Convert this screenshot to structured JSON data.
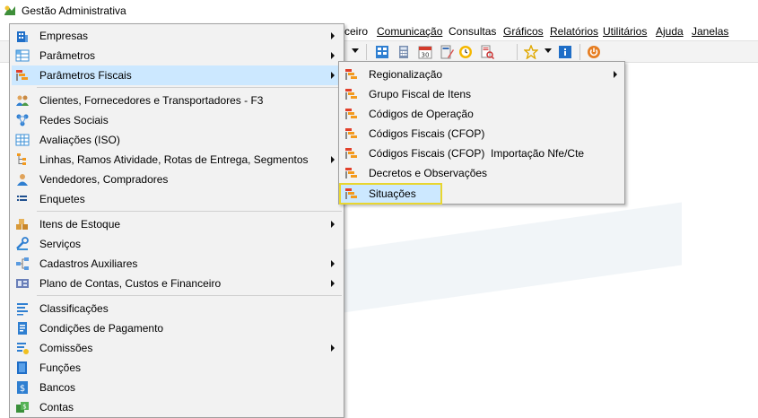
{
  "window": {
    "title": "Gestão Administrativa"
  },
  "menubar": {
    "items": [
      {
        "label": "ceiro",
        "underline_index": -1
      },
      {
        "label": "Comunicação",
        "underline_index": 0
      },
      {
        "label": "Consultas",
        "underline_index": 1
      },
      {
        "label": "Gráficos",
        "underline_index": 0
      },
      {
        "label": "Relatórios",
        "underline_index": 0
      },
      {
        "label": "Utilitários",
        "underline_index": 0
      },
      {
        "label": "Ajuda",
        "underline_index": 0
      },
      {
        "label": "Janelas",
        "underline_index": 0
      }
    ]
  },
  "main_menu": {
    "items": [
      {
        "label": "Empresas",
        "icon": "building-icon",
        "submenu": true
      },
      {
        "label": "Parâmetros",
        "icon": "grid-icon",
        "submenu": true
      },
      {
        "label": "Parâmetros Fiscais",
        "icon": "fiscal-list-icon",
        "submenu": true,
        "highlighted": true
      },
      {
        "label": "Clientes, Fornecedores e Transportadores - F3",
        "icon": "people-icon",
        "submenu": false
      },
      {
        "label": "Redes Sociais",
        "icon": "network-icon",
        "submenu": false
      },
      {
        "label": "Avaliações (ISO)",
        "icon": "table-icon",
        "submenu": false
      },
      {
        "label": "Linhas, Ramos Atividade, Rotas de Entrega, Segmentos",
        "icon": "tree-icon",
        "submenu": true
      },
      {
        "label": "Vendedores, Compradores",
        "icon": "user-icon",
        "submenu": false
      },
      {
        "label": "Enquetes",
        "icon": "list-icon",
        "submenu": false
      },
      {
        "label": "Itens de Estoque",
        "icon": "boxes-icon",
        "submenu": true
      },
      {
        "label": "Serviços",
        "icon": "tools-icon",
        "submenu": false
      },
      {
        "label": "Cadastros Auxiliares",
        "icon": "nodes-icon",
        "submenu": true
      },
      {
        "label": "Plano de Contas, Custos e Financeiro",
        "icon": "ledger-icon",
        "submenu": true
      },
      {
        "label": "Classificações",
        "icon": "lines-icon",
        "submenu": false
      },
      {
        "label": "Condições de Pagamento",
        "icon": "document-icon",
        "submenu": false
      },
      {
        "label": "Comissões",
        "icon": "commission-icon",
        "submenu": true
      },
      {
        "label": "Funções",
        "icon": "function-icon",
        "submenu": false
      },
      {
        "label": "Bancos",
        "icon": "bank-icon",
        "submenu": false
      },
      {
        "label": "Contas",
        "icon": "accounts-icon",
        "submenu": false
      }
    ]
  },
  "fiscal_submenu": {
    "items": [
      {
        "label": "Regionalização",
        "submenu": true
      },
      {
        "label": "Grupo Fiscal de Itens",
        "submenu": false
      },
      {
        "label": "Códigos de Operação",
        "submenu": false
      },
      {
        "label": "Códigos Fiscais (CFOP)",
        "submenu": false
      },
      {
        "label": "Códigos Fiscais (CFOP)  Importação Nfe/Cte",
        "submenu": false
      },
      {
        "label": "Decretos e Observações",
        "submenu": false
      },
      {
        "label": "Situações",
        "submenu": false,
        "highlighted": true
      }
    ]
  },
  "colors": {
    "menu_bg": "#f2f2f2",
    "highlight": "#cce8ff",
    "highlight_outline": "#e8d630",
    "fiscal_icon_orange": "#f39a1e",
    "fiscal_icon_red": "#e2402a"
  }
}
